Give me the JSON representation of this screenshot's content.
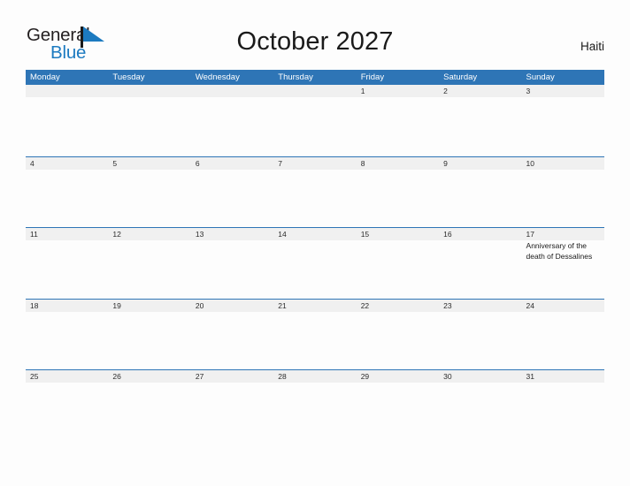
{
  "brand": {
    "name_part1": "General",
    "name_part2": "Blue",
    "flag_icon": "flag-triangle-icon",
    "accent_color": "#1c7ac0"
  },
  "header": {
    "title": "October 2027",
    "country": "Haiti"
  },
  "colors": {
    "header_blue": "#2e75b6",
    "row_band": "#f0f0f0",
    "page_background": "#fdfdfd",
    "text": "#1a1a1a"
  },
  "calendar": {
    "month": "October",
    "year": "2027",
    "weekdays": [
      "Monday",
      "Tuesday",
      "Wednesday",
      "Thursday",
      "Friday",
      "Saturday",
      "Sunday"
    ],
    "weeks": [
      [
        {
          "day": "",
          "event": ""
        },
        {
          "day": "",
          "event": ""
        },
        {
          "day": "",
          "event": ""
        },
        {
          "day": "",
          "event": ""
        },
        {
          "day": "1",
          "event": ""
        },
        {
          "day": "2",
          "event": ""
        },
        {
          "day": "3",
          "event": ""
        }
      ],
      [
        {
          "day": "4",
          "event": ""
        },
        {
          "day": "5",
          "event": ""
        },
        {
          "day": "6",
          "event": ""
        },
        {
          "day": "7",
          "event": ""
        },
        {
          "day": "8",
          "event": ""
        },
        {
          "day": "9",
          "event": ""
        },
        {
          "day": "10",
          "event": ""
        }
      ],
      [
        {
          "day": "11",
          "event": ""
        },
        {
          "day": "12",
          "event": ""
        },
        {
          "day": "13",
          "event": ""
        },
        {
          "day": "14",
          "event": ""
        },
        {
          "day": "15",
          "event": ""
        },
        {
          "day": "16",
          "event": ""
        },
        {
          "day": "17",
          "event": "Anniversary of the death of Dessalines"
        }
      ],
      [
        {
          "day": "18",
          "event": ""
        },
        {
          "day": "19",
          "event": ""
        },
        {
          "day": "20",
          "event": ""
        },
        {
          "day": "21",
          "event": ""
        },
        {
          "day": "22",
          "event": ""
        },
        {
          "day": "23",
          "event": ""
        },
        {
          "day": "24",
          "event": ""
        }
      ],
      [
        {
          "day": "25",
          "event": ""
        },
        {
          "day": "26",
          "event": ""
        },
        {
          "day": "27",
          "event": ""
        },
        {
          "day": "28",
          "event": ""
        },
        {
          "day": "29",
          "event": ""
        },
        {
          "day": "30",
          "event": ""
        },
        {
          "day": "31",
          "event": ""
        }
      ]
    ]
  }
}
